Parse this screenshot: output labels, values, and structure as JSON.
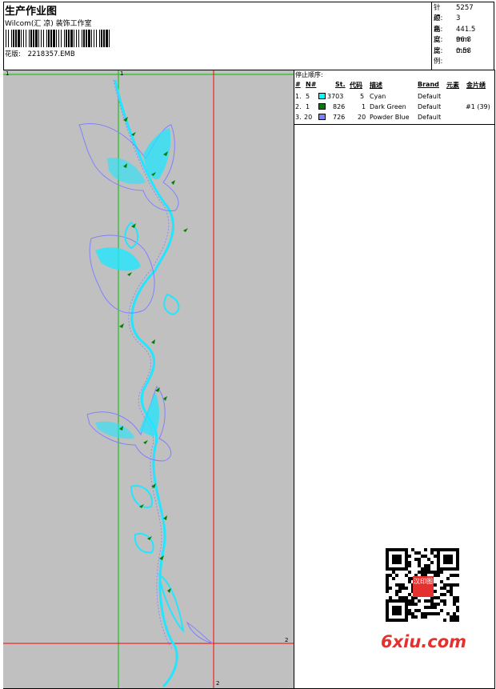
{
  "header": {
    "title": "生产作业图",
    "subtitle": "Wilcom(汇 凉) 装饰工作室",
    "design_label": "花版:",
    "design_file": "2218357.EMB"
  },
  "stats": [
    {
      "key": "针迹:",
      "value": "5257"
    },
    {
      "key": "颜色:",
      "value": "3"
    },
    {
      "key": "高度:",
      "value": "441.5 mm"
    },
    {
      "key": "宽度:",
      "value": "96.8 mm"
    },
    {
      "key": "比例:",
      "value": "0.58"
    }
  ],
  "stops": {
    "title": "停止顺序:",
    "headers": {
      "num": "#",
      "n": "N#",
      "st": "St.",
      "code": "代码",
      "desc": "描述",
      "brand": "Brand",
      "elem": "元素",
      "seq": "金片绣"
    },
    "rows": [
      {
        "num": "1.",
        "n": "5",
        "color": "#00ffff",
        "st": "3703",
        "code": "5",
        "desc": "Cyan",
        "brand": "Default",
        "seq": ""
      },
      {
        "num": "2.",
        "n": "1",
        "color": "#008000",
        "st": "826",
        "code": "1",
        "desc": "Dark Green",
        "brand": "Default",
        "seq": "#1 (39)"
      },
      {
        "num": "3.",
        "n": "20",
        "color": "#8080ff",
        "st": "726",
        "code": "20",
        "desc": "Powder Blue",
        "brand": "Default",
        "seq": ""
      }
    ]
  },
  "canvas": {
    "marker_top_left": "1",
    "marker_top_mid": "1",
    "marker_right": "2",
    "marker_bottom": "2"
  },
  "watermark": {
    "text": "6xiu.com",
    "seal_text": "汉印图"
  }
}
